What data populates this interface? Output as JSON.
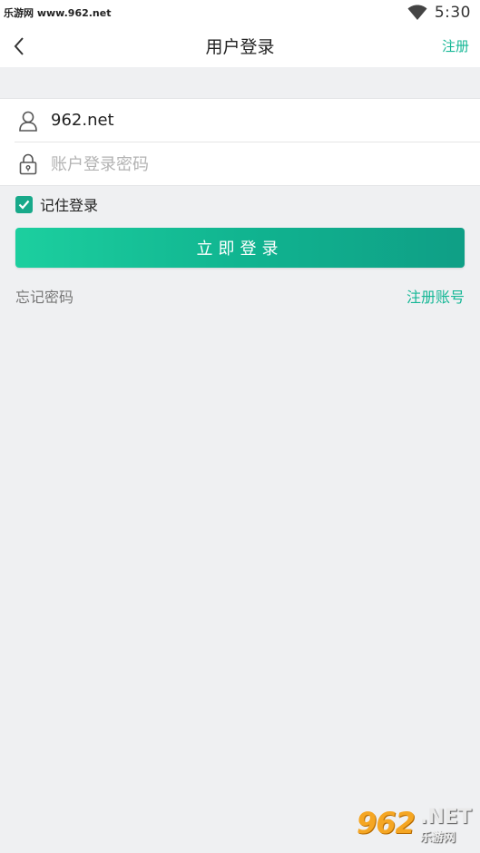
{
  "status_bar": {
    "site": "乐游网 www.962.net",
    "time": "5:30",
    "icons": [
      "wifi-icon"
    ]
  },
  "header": {
    "title": "用户登录",
    "right_link": "注册",
    "back_icon": "back-arrow-icon"
  },
  "form": {
    "username_value": "962.net",
    "password_placeholder": "账户登录密码",
    "username_icon": "user-icon",
    "password_icon": "lock-icon"
  },
  "remember": {
    "label": "记住登录",
    "checked": true
  },
  "login_button": "立即登录",
  "links": {
    "forgot": "忘记密码",
    "signup": "注册账号"
  },
  "watermark": {
    "number": "962",
    "suffix": ".NET",
    "sub": "乐游网"
  },
  "colors": {
    "accent": "#16b796",
    "button_start": "#1ccf9f",
    "button_end": "#0f9f86",
    "background": "#eff0f2"
  }
}
